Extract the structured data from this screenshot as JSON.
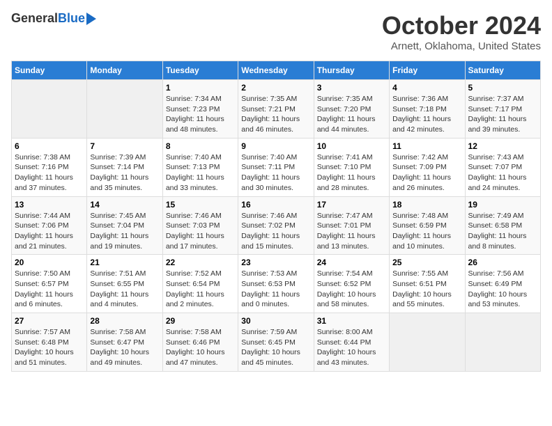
{
  "header": {
    "logo_general": "General",
    "logo_blue": "Blue",
    "month_title": "October 2024",
    "location": "Arnett, Oklahoma, United States"
  },
  "days_of_week": [
    "Sunday",
    "Monday",
    "Tuesday",
    "Wednesday",
    "Thursday",
    "Friday",
    "Saturday"
  ],
  "weeks": [
    [
      {
        "num": "",
        "empty": true
      },
      {
        "num": "",
        "empty": true
      },
      {
        "num": "1",
        "sunrise": "7:34 AM",
        "sunset": "7:23 PM",
        "daylight": "11 hours and 48 minutes."
      },
      {
        "num": "2",
        "sunrise": "7:35 AM",
        "sunset": "7:21 PM",
        "daylight": "11 hours and 46 minutes."
      },
      {
        "num": "3",
        "sunrise": "7:35 AM",
        "sunset": "7:20 PM",
        "daylight": "11 hours and 44 minutes."
      },
      {
        "num": "4",
        "sunrise": "7:36 AM",
        "sunset": "7:18 PM",
        "daylight": "11 hours and 42 minutes."
      },
      {
        "num": "5",
        "sunrise": "7:37 AM",
        "sunset": "7:17 PM",
        "daylight": "11 hours and 39 minutes."
      }
    ],
    [
      {
        "num": "6",
        "sunrise": "7:38 AM",
        "sunset": "7:16 PM",
        "daylight": "11 hours and 37 minutes."
      },
      {
        "num": "7",
        "sunrise": "7:39 AM",
        "sunset": "7:14 PM",
        "daylight": "11 hours and 35 minutes."
      },
      {
        "num": "8",
        "sunrise": "7:40 AM",
        "sunset": "7:13 PM",
        "daylight": "11 hours and 33 minutes."
      },
      {
        "num": "9",
        "sunrise": "7:40 AM",
        "sunset": "7:11 PM",
        "daylight": "11 hours and 30 minutes."
      },
      {
        "num": "10",
        "sunrise": "7:41 AM",
        "sunset": "7:10 PM",
        "daylight": "11 hours and 28 minutes."
      },
      {
        "num": "11",
        "sunrise": "7:42 AM",
        "sunset": "7:09 PM",
        "daylight": "11 hours and 26 minutes."
      },
      {
        "num": "12",
        "sunrise": "7:43 AM",
        "sunset": "7:07 PM",
        "daylight": "11 hours and 24 minutes."
      }
    ],
    [
      {
        "num": "13",
        "sunrise": "7:44 AM",
        "sunset": "7:06 PM",
        "daylight": "11 hours and 21 minutes."
      },
      {
        "num": "14",
        "sunrise": "7:45 AM",
        "sunset": "7:04 PM",
        "daylight": "11 hours and 19 minutes."
      },
      {
        "num": "15",
        "sunrise": "7:46 AM",
        "sunset": "7:03 PM",
        "daylight": "11 hours and 17 minutes."
      },
      {
        "num": "16",
        "sunrise": "7:46 AM",
        "sunset": "7:02 PM",
        "daylight": "11 hours and 15 minutes."
      },
      {
        "num": "17",
        "sunrise": "7:47 AM",
        "sunset": "7:01 PM",
        "daylight": "11 hours and 13 minutes."
      },
      {
        "num": "18",
        "sunrise": "7:48 AM",
        "sunset": "6:59 PM",
        "daylight": "11 hours and 10 minutes."
      },
      {
        "num": "19",
        "sunrise": "7:49 AM",
        "sunset": "6:58 PM",
        "daylight": "11 hours and 8 minutes."
      }
    ],
    [
      {
        "num": "20",
        "sunrise": "7:50 AM",
        "sunset": "6:57 PM",
        "daylight": "11 hours and 6 minutes."
      },
      {
        "num": "21",
        "sunrise": "7:51 AM",
        "sunset": "6:55 PM",
        "daylight": "11 hours and 4 minutes."
      },
      {
        "num": "22",
        "sunrise": "7:52 AM",
        "sunset": "6:54 PM",
        "daylight": "11 hours and 2 minutes."
      },
      {
        "num": "23",
        "sunrise": "7:53 AM",
        "sunset": "6:53 PM",
        "daylight": "11 hours and 0 minutes."
      },
      {
        "num": "24",
        "sunrise": "7:54 AM",
        "sunset": "6:52 PM",
        "daylight": "10 hours and 58 minutes."
      },
      {
        "num": "25",
        "sunrise": "7:55 AM",
        "sunset": "6:51 PM",
        "daylight": "10 hours and 55 minutes."
      },
      {
        "num": "26",
        "sunrise": "7:56 AM",
        "sunset": "6:49 PM",
        "daylight": "10 hours and 53 minutes."
      }
    ],
    [
      {
        "num": "27",
        "sunrise": "7:57 AM",
        "sunset": "6:48 PM",
        "daylight": "10 hours and 51 minutes."
      },
      {
        "num": "28",
        "sunrise": "7:58 AM",
        "sunset": "6:47 PM",
        "daylight": "10 hours and 49 minutes."
      },
      {
        "num": "29",
        "sunrise": "7:58 AM",
        "sunset": "6:46 PM",
        "daylight": "10 hours and 47 minutes."
      },
      {
        "num": "30",
        "sunrise": "7:59 AM",
        "sunset": "6:45 PM",
        "daylight": "10 hours and 45 minutes."
      },
      {
        "num": "31",
        "sunrise": "8:00 AM",
        "sunset": "6:44 PM",
        "daylight": "10 hours and 43 minutes."
      },
      {
        "num": "",
        "empty": true
      },
      {
        "num": "",
        "empty": true
      }
    ]
  ]
}
